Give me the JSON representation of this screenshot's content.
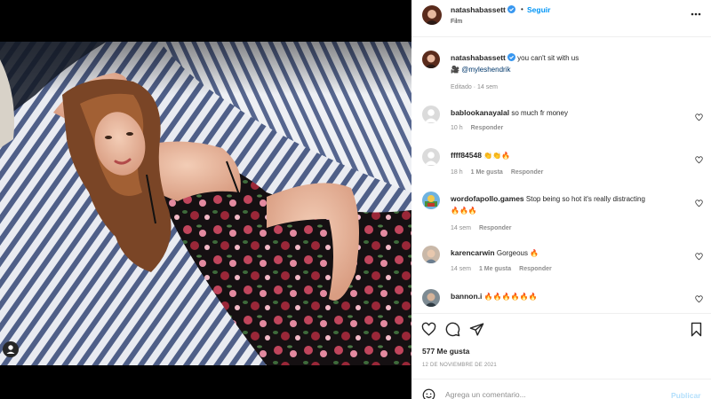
{
  "colors": {
    "accent": "#0095f6",
    "verified": "#3897f0",
    "text": "#262626",
    "muted": "#8e8e8e",
    "mention": "#00376b",
    "publish_disabled": "#b2dffc"
  },
  "post": {
    "username": "natashabassett",
    "dot": "•",
    "follow_label": "Seguir",
    "location": "Film",
    "tag_icon": "user-tag-icon"
  },
  "caption": {
    "username": "natashabassett",
    "text": "you can't sit with us",
    "emoji": "🎥",
    "mention": "@myleshendrik",
    "edited": "Editado",
    "age": "14 sem"
  },
  "comments": [
    {
      "username": "bablookanayalal",
      "text": "so much fr money",
      "text2": "",
      "age": "10 h",
      "likes": "",
      "reply": "Responder"
    },
    {
      "username": "ffff84548",
      "text": "👏👏🔥",
      "text2": "",
      "age": "18 h",
      "likes": "1 Me gusta",
      "reply": "Responder"
    },
    {
      "username": "wordofapollo.games",
      "text": "Stop being so hot it's really distracting",
      "text2": "🔥🔥🔥",
      "age": "14 sem",
      "likes": "",
      "reply": "Responder"
    },
    {
      "username": "karencarwin",
      "text": "Gorgeous 🔥",
      "text2": "",
      "age": "14 sem",
      "likes": "1 Me gusta",
      "reply": "Responder"
    },
    {
      "username": "bannon.i",
      "text": "🔥🔥🔥🔥🔥🔥",
      "text2": "",
      "age": "",
      "likes": "",
      "reply": ""
    }
  ],
  "footer": {
    "likes": "577 Me gusta",
    "date": "12 DE NOVIEMBRE DE 2021",
    "comment_placeholder": "Agrega un comentario...",
    "publish_label": "Publicar"
  }
}
